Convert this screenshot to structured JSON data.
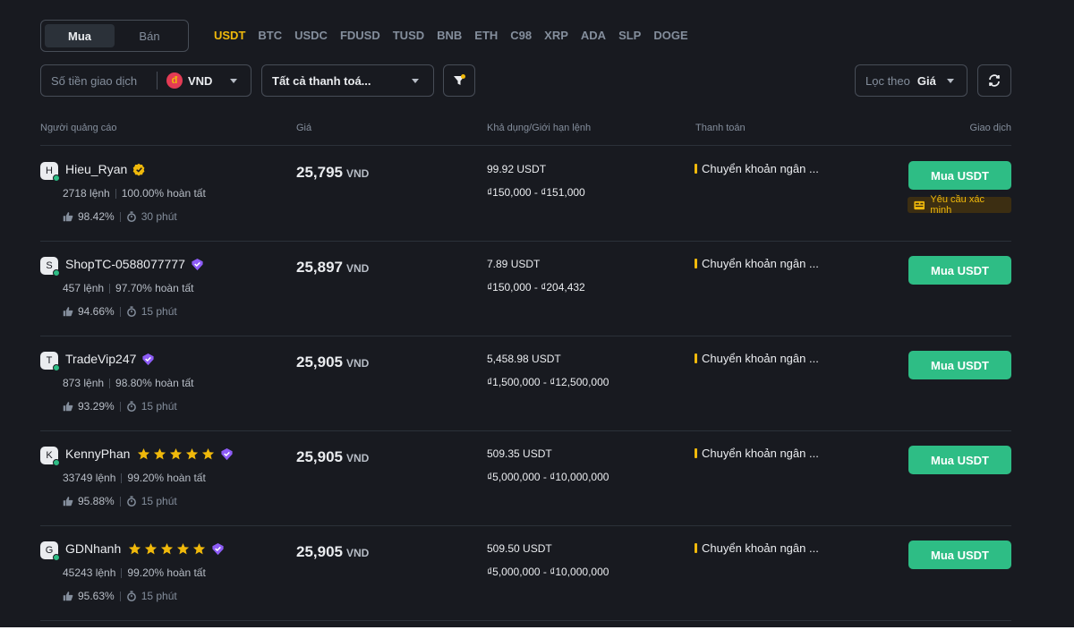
{
  "trade_toggle": {
    "buy": "Mua",
    "sell": "Bán",
    "active": "buy"
  },
  "coins": [
    "USDT",
    "BTC",
    "USDC",
    "FDUSD",
    "TUSD",
    "BNB",
    "ETH",
    "C98",
    "XRP",
    "ADA",
    "SLP",
    "DOGE"
  ],
  "active_coin": "USDT",
  "filters": {
    "amount_placeholder": "Số tiền giao dịch",
    "currency_symbol": "đ",
    "currency": "VND",
    "payment": "Tất cả thanh toá...",
    "sort_label": "Lọc theo",
    "sort_value": "Giá"
  },
  "columns": {
    "advertiser": "Người quảng cáo",
    "price": "Giá",
    "available": "Khả dụng/Giới hạn lệnh",
    "payment": "Thanh toán",
    "trade": "Giao dịch"
  },
  "colors": {
    "accent": "#f0b90b",
    "buy": "#2ebd85",
    "background": "#181a20"
  },
  "rows": [
    {
      "initial": "H",
      "name": "Hieu_Ryan",
      "badge": "gold-verified-icon",
      "stars": 0,
      "orders": "2718 lệnh",
      "completion": "100.00% hoàn tất",
      "rating": "98.42%",
      "time": "30 phút",
      "price": "25,795",
      "unit": "VND",
      "available": "99.92 USDT",
      "limit": "₫150,000 - ₫151,000",
      "payment": "Chuyển khoản ngân ...",
      "button": "Mua USDT",
      "verify": "Yêu cầu xác minh"
    },
    {
      "initial": "S",
      "name": "ShopTC-0588077777",
      "badge": "purple-verified-icon",
      "stars": 0,
      "orders": "457 lệnh",
      "completion": "97.70% hoàn tất",
      "rating": "94.66%",
      "time": "15 phút",
      "price": "25,897",
      "unit": "VND",
      "available": "7.89 USDT",
      "limit": "₫150,000 - ₫204,432",
      "payment": "Chuyển khoản ngân ...",
      "button": "Mua USDT",
      "verify": ""
    },
    {
      "initial": "T",
      "name": "TradeVip247",
      "badge": "purple-verified-icon",
      "stars": 0,
      "orders": "873 lệnh",
      "completion": "98.80% hoàn tất",
      "rating": "93.29%",
      "time": "15 phút",
      "price": "25,905",
      "unit": "VND",
      "available": "5,458.98 USDT",
      "limit": "₫1,500,000 - ₫12,500,000",
      "payment": "Chuyển khoản ngân ...",
      "button": "Mua USDT",
      "verify": ""
    },
    {
      "initial": "K",
      "name": "KennyPhan",
      "badge": "purple-verified-icon",
      "stars": 5,
      "orders": "33749 lệnh",
      "completion": "99.20% hoàn tất",
      "rating": "95.88%",
      "time": "15 phút",
      "price": "25,905",
      "unit": "VND",
      "available": "509.35 USDT",
      "limit": "₫5,000,000 - ₫10,000,000",
      "payment": "Chuyển khoản ngân ...",
      "button": "Mua USDT",
      "verify": ""
    },
    {
      "initial": "G",
      "name": "GDNhanh",
      "badge": "purple-verified-icon",
      "stars": 5,
      "orders": "45243 lệnh",
      "completion": "99.20% hoàn tất",
      "rating": "95.63%",
      "time": "15 phút",
      "price": "25,905",
      "unit": "VND",
      "available": "509.50 USDT",
      "limit": "₫5,000,000 - ₫10,000,000",
      "payment": "Chuyển khoản ngân ...",
      "button": "Mua USDT",
      "verify": ""
    }
  ]
}
